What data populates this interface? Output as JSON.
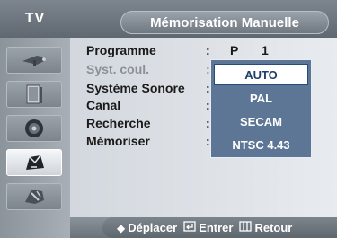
{
  "header": {
    "tv_label": "TV",
    "title": "Mémorisation Manuelle"
  },
  "menu": {
    "rows": [
      {
        "label": "Programme",
        "value": "P",
        "number": "1",
        "dimmed": false
      },
      {
        "label": "Syst. coul.",
        "value": "",
        "number": "",
        "dimmed": true
      },
      {
        "label": "Système Sonore",
        "value": "",
        "number": "",
        "dimmed": false
      },
      {
        "label": "Canal",
        "value": "",
        "number": "",
        "dimmed": false
      },
      {
        "label": "Recherche",
        "value": "",
        "number": "",
        "dimmed": false
      },
      {
        "label": "Mémoriser",
        "value": "",
        "number": "",
        "dimmed": false
      }
    ],
    "colon": ":"
  },
  "dropdown": {
    "options": [
      "AUTO",
      "PAL",
      "SECAM",
      "NTSC 4.43"
    ],
    "selected": "AUTO"
  },
  "footer": {
    "move_icon": "up-down-arrows-icon",
    "move_label": "Déplacer",
    "enter_icon": "enter-icon",
    "enter_label": "Entrer",
    "return_icon": "menu-return-icon",
    "return_label": "Retour"
  },
  "sidebar": {
    "icons": [
      "antenna-icon",
      "picture-icon",
      "speaker-icon",
      "channel-icon",
      "setup-icon"
    ],
    "active_index": 3
  },
  "colors": {
    "dropdown_bg": "#5d7696",
    "selected_text": "#1f3e69",
    "header_bg": "#5f6770"
  }
}
